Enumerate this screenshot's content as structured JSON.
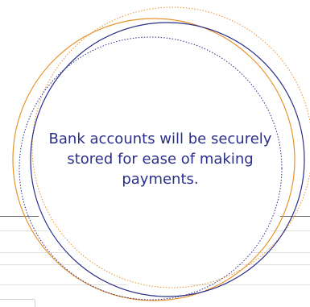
{
  "tooltip": {
    "text": "Bank accounts will be securely stored for ease of making payments."
  },
  "colors": {
    "accent_orange": "#e8922a",
    "accent_navy": "#2b2f8a",
    "divider": "#6b6b6b",
    "field_border": "#dedede"
  }
}
